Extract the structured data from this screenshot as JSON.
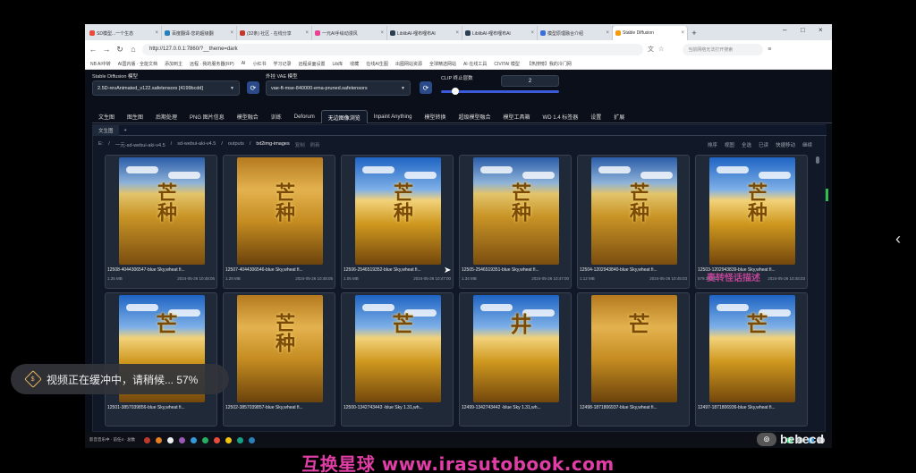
{
  "browser": {
    "tabs": [
      "SD模型...一个生态",
      "百度翻译-您的超级翻",
      "(32条) 社区 · 在线分享",
      "一元AI手绘动漫风",
      "LiblibAI-哩布哩布AI",
      "LiblibAI-哩布哩布AI",
      "模型原理融合介绍",
      "Stable Diffusion"
    ],
    "url": "http://127.0.0.1:7860/?__theme=dark",
    "search_placeholder": "当前网络无法打开搜索",
    "bookmarks": [
      "NB AI中转",
      "AI国内版 · 全能文档",
      "添加到主",
      "远程 · 我的服务器(RP)",
      "AI",
      "小红书",
      "学习记录",
      "远程桌面设置",
      "Lib库",
      "收藏",
      "在线AI生图",
      "出图网站资源",
      "全球精选网站",
      "AI·在线工具",
      "CIVITAI 模型",
      "【热搜榜】我的冷门网"
    ]
  },
  "app": {
    "sd_model_label": "Stable Diffusion 模型",
    "sd_model_value": "2.5D-revAnimated_v122.safetensors [4199bcdd]",
    "vae_label": "外挂 VAE 模型",
    "vae_value": "vae-ft-mse-840000-ema-pruned.safetensors",
    "clip_label": "CLIP 终止层数",
    "clip_value": "2",
    "clip_level": 0.12,
    "main_tabs": [
      "文生图",
      "图生图",
      "后期处理",
      "PNG 图片信息",
      "模型融合",
      "训练",
      "Deforum",
      "无边图像浏览",
      "Inpaint Anything",
      "模型转换",
      "超级模型融合",
      "模型工具箱",
      "WD 1.4 标签器",
      "设置",
      "扩展"
    ],
    "active_tab": 7,
    "sub_tabs": [
      "文生图",
      "+"
    ],
    "crumbs": [
      "E:",
      "/",
      "一元-sd-webui-aki-v4.5",
      "/",
      "sd-webui-aki-v4.5",
      "/",
      "outputs",
      "/",
      "txt2img-images"
    ],
    "crumb_actions": [
      "复制",
      "刷新"
    ],
    "actions": [
      "排序",
      "视图",
      "全选",
      "已读",
      "快捷移动",
      "继续"
    ],
    "cards": [
      {
        "name": "12508-4044306547-blue Sky,wheat fi...",
        "size": "1.25 MB",
        "date": "2024-05-26 10:48:05"
      },
      {
        "name": "12507-4044306546-blue Sky,wheat fi...",
        "size": "1.29 MB",
        "date": "2024-05-26 10:48:05"
      },
      {
        "name": "12506-2546519352-blue Sky,wheat fi...",
        "size": "1.05 MB",
        "date": "2024-05-26 10:47:00"
      },
      {
        "name": "12505-2546519351-blue Sky,wheat fi...",
        "size": "1.34 MB",
        "date": "2024-05-26 10:47:00"
      },
      {
        "name": "12504-1202943840-blue Sky,wheat fi...",
        "size": "1.12 MB",
        "date": "2024-05-26 10:45:03"
      },
      {
        "name": "12503-1202943839-blue Sky,wheat fi...",
        "size": "579.35 KB",
        "date": "2024-05-26 10:45:03"
      },
      {
        "name": "12501-3857039856-blue Sky,wheat fi...",
        "size": "",
        "date": ""
      },
      {
        "name": "12502-3857039857-blue Sky,wheat fi...",
        "size": "",
        "date": ""
      },
      {
        "name": "12500-1342743443 -blue Sky 1.31,wh...",
        "size": "",
        "date": ""
      },
      {
        "name": "12499-1342743442 -blue Sky 1.31,wh...",
        "size": "",
        "date": ""
      },
      {
        "name": "12498-1871806937-blue Sky,wheat fi...",
        "size": "",
        "date": ""
      },
      {
        "name": "12497-1871806936-blue Sky,wheat fi...",
        "size": "",
        "date": ""
      }
    ],
    "thumb_text": "芒种",
    "thumb_text_alt": "芒",
    "thumb_text_alt2": "井",
    "thumb_text_seed": "芒种"
  },
  "overlay": {
    "toast": "视频正在缓冲中，请稍候... 57%",
    "toast_icon": "$",
    "pink_text": "麦转怪话描述",
    "wm_logo": "⊚",
    "wm_name": "bebecd",
    "watermark": "互换星球 www.irasutobook.com",
    "taskbar_text": "影音音乐中 · 前任4 · 总数"
  }
}
